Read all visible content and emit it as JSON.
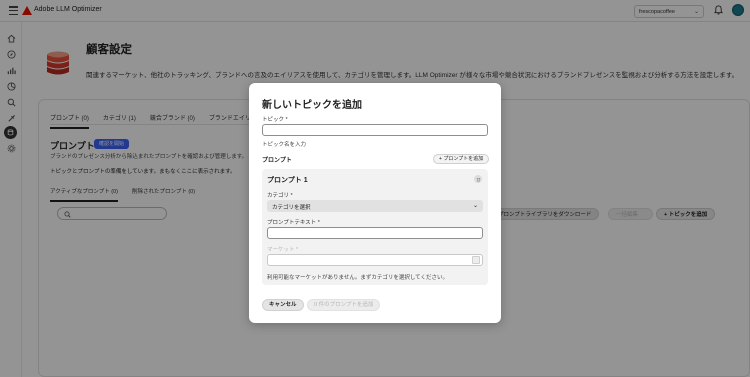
{
  "app": {
    "title": "Adobe LLM Optimizer",
    "org_select": "frescopacoffee"
  },
  "page": {
    "title": "顧客設定",
    "description": "関連するマーケット、他社のトラッキング、ブランドへの言及のエイリアスを使用して、カテゴリを管理します。LLM Optimizer が様々な市場や競合状況におけるブランドプレゼンスを監視および分析する方法を設定します。"
  },
  "tabs": [
    "プロンプト (0)",
    "カテゴリ (1)",
    "競合ブランド (0)",
    "ブランドエイリアス (0)"
  ],
  "prompts_panel": {
    "heading": "プロンプト",
    "badge": "確認を開始",
    "subtitle": "ブランドのプレゼンス分析から除込まれたプロンプトを確認および管理します。",
    "note": "トピックとプロンプトの準備をしています。まもなくここに表示されます。",
    "subtabs": [
      "アクティブなプロンプト (0)",
      "削除されたプロンプト (0)"
    ],
    "download_label": "プロンプトライブラリをダウンロード",
    "ghost_label": "一括編集",
    "add_topic_label": "トピックを追加"
  },
  "modal": {
    "title": "新しいトピックを追加",
    "topic_label": "トピック *",
    "topic_value": "",
    "topic_help": "トピック名を入力",
    "prompts_section": "プロンプト",
    "add_prompt_label": "プロンプトを追加",
    "prompt_card": {
      "title": "プロンプト 1",
      "category_label": "カテゴリ *",
      "category_value": "カテゴリを選択",
      "prompt_text_label": "プロンプトテキスト *",
      "prompt_text_value": "",
      "market_label": "マーケット *",
      "market_value": "",
      "market_help": "利用可能なマーケットがありません。まずカテゴリを選択してください。"
    },
    "cancel_label": "キャンセル",
    "submit_label": "0 件のプロンプトを追加"
  },
  "colors": {
    "brand_red": "#eb1000",
    "badge_blue": "#3b63fb",
    "overlay": "rgba(0,0,0,0.42)"
  },
  "icons": [
    "menu-icon",
    "adobe-logo-icon",
    "bell-icon",
    "avatar",
    "home-icon",
    "compass-icon",
    "bar-chart-icon",
    "pie-icon",
    "search-icon",
    "wrench-icon",
    "customer-settings-icon",
    "gear-icon",
    "database-stack-icon",
    "trash-icon",
    "plus-icon",
    "chevron-down-icon"
  ]
}
